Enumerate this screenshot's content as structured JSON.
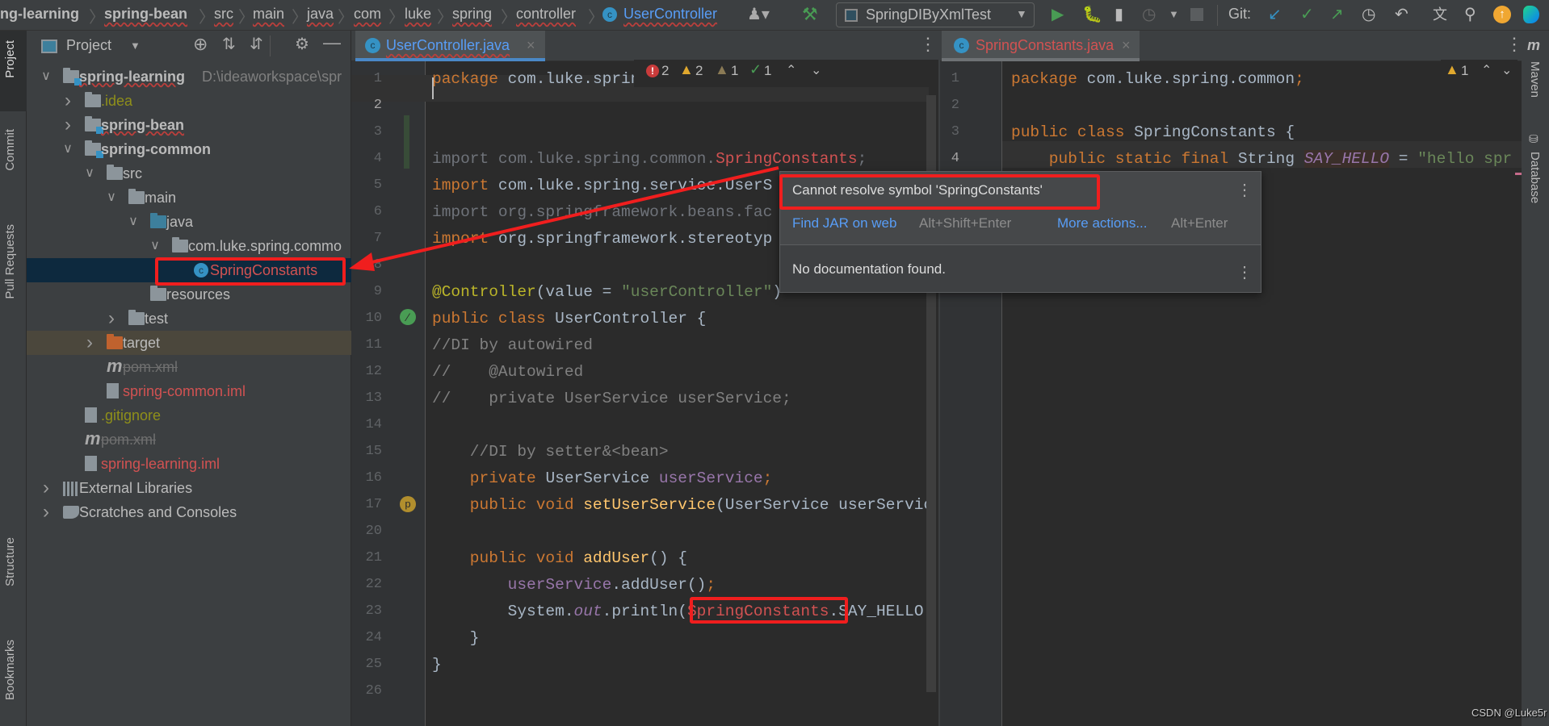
{
  "breadcrumb": [
    "ng-learning",
    "spring-bean",
    "src",
    "main",
    "java",
    "com",
    "luke",
    "spring",
    "controller",
    "UserController"
  ],
  "toolbar": {
    "run_config": "SpringDIByXmlTest",
    "git_label": "Git:"
  },
  "left_strip": [
    "Project",
    "Commit",
    "Pull Requests",
    "Structure",
    "Bookmarks"
  ],
  "right_strip": [
    "Maven",
    "Database"
  ],
  "project": {
    "title": "Project",
    "root_path": "D:\\ideaworkspace\\spr",
    "tree": [
      {
        "level": 0,
        "chevron": "down",
        "icon": "module",
        "label": "spring-learning",
        "style": "bold"
      },
      {
        "level": 1,
        "chevron": "right",
        "icon": "folder",
        "label": ".idea",
        "style": "ignored"
      },
      {
        "level": 1,
        "chevron": "right",
        "icon": "module",
        "label": "spring-bean",
        "style": "bold"
      },
      {
        "level": 1,
        "chevron": "down",
        "icon": "module",
        "label": "spring-common",
        "style": "bold"
      },
      {
        "level": 2,
        "chevron": "down",
        "icon": "folder",
        "label": "src",
        "style": "normal"
      },
      {
        "level": 3,
        "chevron": "down",
        "icon": "folder",
        "label": "main",
        "style": "normal"
      },
      {
        "level": 4,
        "chevron": "down",
        "icon": "source-folder",
        "label": "java",
        "style": "normal"
      },
      {
        "level": 5,
        "chevron": "down",
        "icon": "package",
        "label": "com.luke.spring.commo",
        "style": "normal"
      },
      {
        "level": 6,
        "chevron": "",
        "icon": "class",
        "label": "SpringConstants",
        "style": "error",
        "selected": true
      },
      {
        "level": 4,
        "chevron": "",
        "icon": "resources-folder",
        "label": "resources",
        "style": "normal"
      },
      {
        "level": 3,
        "chevron": "right",
        "icon": "folder",
        "label": "test",
        "style": "normal"
      },
      {
        "level": 2,
        "chevron": "right",
        "icon": "excluded-folder",
        "label": "target",
        "style": "normal",
        "highlight": true
      },
      {
        "level": 2,
        "chevron": "",
        "icon": "maven",
        "label": "pom.xml",
        "style": "deleted"
      },
      {
        "level": 2,
        "chevron": "",
        "icon": "iml-file",
        "label": "spring-common.iml",
        "style": "error"
      },
      {
        "level": 1,
        "chevron": "",
        "icon": "ignore-file",
        "label": ".gitignore",
        "style": "ignored"
      },
      {
        "level": 1,
        "chevron": "",
        "icon": "maven",
        "label": "pom.xml",
        "style": "deleted"
      },
      {
        "level": 1,
        "chevron": "",
        "icon": "iml-file",
        "label": "spring-learning.iml",
        "style": "error"
      },
      {
        "level": 0,
        "chevron": "right",
        "icon": "libraries",
        "label": "External Libraries",
        "style": "normal"
      },
      {
        "level": 0,
        "chevron": "right",
        "icon": "scratches",
        "label": "Scratches and Consoles",
        "style": "normal"
      }
    ]
  },
  "editor_left": {
    "tab": "UserController.java",
    "inspections": {
      "errors": "2",
      "warnings": "2",
      "weak_warnings": "1",
      "typos": "1"
    },
    "lines": [
      {
        "n": "1",
        "t": [
          [
            "k",
            "package "
          ],
          [
            "",
            "com.luke.spring.controll"
          ]
        ]
      },
      {
        "n": "2",
        "t": []
      },
      {
        "n": "3",
        "t": []
      },
      {
        "n": "4",
        "t": [
          [
            "g",
            "import com.luke.spring.common."
          ],
          [
            "e",
            "SpringConstants"
          ],
          [
            "g",
            ";"
          ]
        ]
      },
      {
        "n": "5",
        "t": [
          [
            "k",
            "import "
          ],
          [
            "",
            "com.luke.spring.service.UserS"
          ]
        ]
      },
      {
        "n": "6",
        "t": [
          [
            "g",
            "import org.springframework.beans.fac"
          ]
        ]
      },
      {
        "n": "7",
        "t": [
          [
            "k",
            "import "
          ],
          [
            "",
            "org.springframework.stereotyp"
          ]
        ]
      },
      {
        "n": "8",
        "t": []
      },
      {
        "n": "9",
        "t": [
          [
            "a",
            "@Controller"
          ],
          [
            "",
            "(value = "
          ],
          [
            "s",
            "\"userController\""
          ],
          [
            "",
            ")"
          ]
        ]
      },
      {
        "n": "10",
        "t": [
          [
            "k",
            "public class "
          ],
          [
            "",
            "UserController {"
          ]
        ]
      },
      {
        "n": "11",
        "t": [
          [
            "c",
            "//DI by autowired"
          ]
        ]
      },
      {
        "n": "12",
        "t": [
          [
            "c",
            "//    @Autowired"
          ]
        ]
      },
      {
        "n": "13",
        "t": [
          [
            "c",
            "//    private UserService userService;"
          ]
        ]
      },
      {
        "n": "14",
        "t": []
      },
      {
        "n": "15",
        "t": [
          [
            "c",
            "    //DI by setter&<bean>"
          ]
        ]
      },
      {
        "n": "16",
        "t": [
          [
            "k",
            "    private "
          ],
          [
            "",
            "UserService "
          ],
          [
            "f",
            "userService"
          ],
          [
            "k",
            ";"
          ]
        ]
      },
      {
        "n": "17",
        "t": [
          [
            "k",
            "    public void "
          ],
          [
            "m",
            "setUserService"
          ],
          [
            "",
            "(UserService userServic"
          ]
        ]
      },
      {
        "n": "20",
        "t": []
      },
      {
        "n": "21",
        "t": [
          [
            "k",
            "    public void "
          ],
          [
            "m",
            "addUser"
          ],
          [
            "",
            "() {"
          ]
        ]
      },
      {
        "n": "22",
        "t": [
          [
            "f",
            "        userService"
          ],
          [
            "",
            ".addUser()"
          ],
          [
            "k",
            ";"
          ]
        ]
      },
      {
        "n": "23",
        "t": [
          [
            "",
            "        System."
          ],
          [
            "fi",
            "out"
          ],
          [
            "",
            ".println("
          ],
          [
            "e",
            "SpringConstants"
          ],
          [
            "",
            ".SAY_HELLO"
          ]
        ]
      },
      {
        "n": "24",
        "t": [
          [
            "",
            "    }"
          ]
        ]
      },
      {
        "n": "25",
        "t": [
          [
            "",
            "}"
          ]
        ]
      },
      {
        "n": "26",
        "t": []
      }
    ]
  },
  "editor_right": {
    "tab": "SpringConstants.java",
    "inspections": {
      "warnings": "1"
    },
    "lines": [
      {
        "n": "1",
        "t": [
          [
            "k",
            "package "
          ],
          [
            "",
            "com.luke.spring.common"
          ],
          [
            "k",
            ";"
          ]
        ]
      },
      {
        "n": "2",
        "t": []
      },
      {
        "n": "3",
        "t": [
          [
            "k",
            "public class "
          ],
          [
            "",
            "SpringConstants {"
          ]
        ]
      },
      {
        "n": "4",
        "t": [
          [
            "k",
            "    public static final "
          ],
          [
            "",
            "String "
          ],
          [
            "ci",
            "SAY_HELLO"
          ],
          [
            "",
            " = "
          ],
          [
            "s",
            "\"hello spr"
          ]
        ]
      }
    ]
  },
  "popup": {
    "message": "Cannot resolve symbol 'SpringConstants'",
    "action1": "Find JAR on web",
    "shortcut1": "Alt+Shift+Enter",
    "action2": "More actions...",
    "shortcut2": "Alt+Enter",
    "doc": "No documentation found."
  },
  "watermark": "CSDN @Luke5r",
  "colors": {
    "accent": "#4a88c7",
    "error": "#bc3f3c",
    "annotation_red": "#f01e1e",
    "link": "#589df6"
  }
}
